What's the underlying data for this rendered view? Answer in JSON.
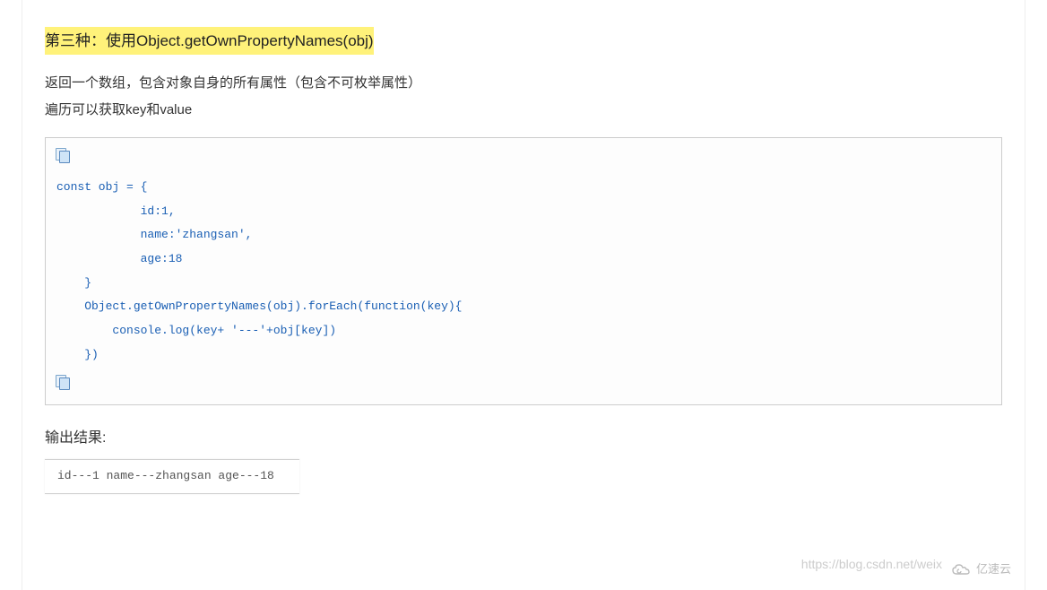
{
  "heading": "第三种：使用Object.getOwnPropertyNames(obj)",
  "desc1": "返回一个数组，包含对象自身的所有属性（包含不可枚举属性）",
  "desc2": "遍历可以获取key和value",
  "code": "const obj = {\n            id:1,\n            name:'zhangsan',\n            age:18\n    }\n    Object.getOwnPropertyNames(obj).forEach(function(key){\n        console.log(key+ '---'+obj[key])\n    })",
  "output_heading": "输出结果:",
  "output_lines": "id---1\nname---zhangsan\nage---18",
  "watermark": "https://blog.csdn.net/weix",
  "logo_text": "亿速云"
}
